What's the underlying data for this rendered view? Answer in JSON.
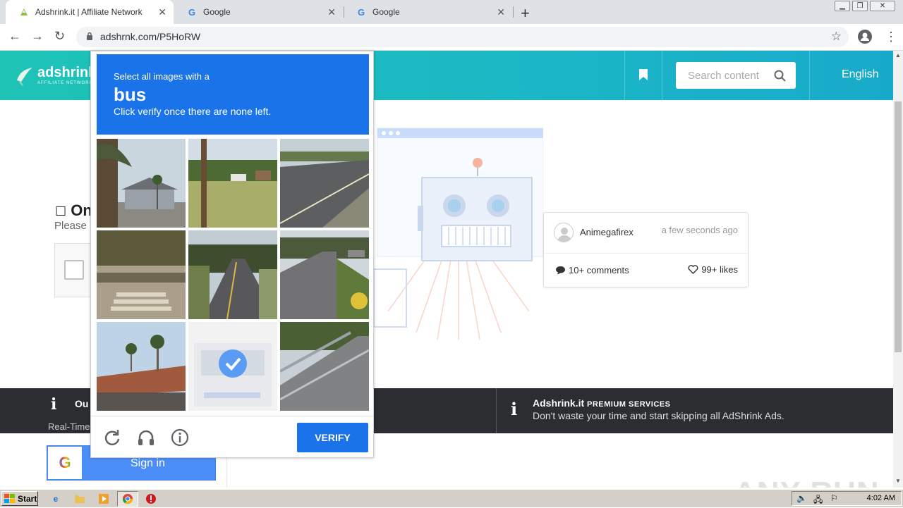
{
  "browser": {
    "tabs": [
      {
        "title": "Adshrink.it | Affiliate Network",
        "active": true
      },
      {
        "title": "Google",
        "active": false
      },
      {
        "title": "Google",
        "active": false
      }
    ],
    "url": "adshrnk.com/P5HoRW"
  },
  "header": {
    "logo_text": "adshrink.it",
    "logo_sub": "AFFILIATE NETWORK",
    "search_placeholder": "Search content",
    "language": "English"
  },
  "main": {
    "title_fragment": "On",
    "subtitle_fragment": "Please",
    "post": {
      "author": "Animegafirex",
      "time": "a few seconds ago",
      "comments": "10+ comments",
      "likes": "99+ likes"
    }
  },
  "banner": {
    "left_icon": "i",
    "left_title": "Ou",
    "left_sub": "Real-Time",
    "right_icon": "i",
    "right_brand": "Adshrink.it",
    "right_title": "PREMIUM SERVICES",
    "right_sub": "Don't waste your time and start skipping all AdShrink Ads."
  },
  "signin": {
    "label": "Sign in",
    "g_letter": "G"
  },
  "captcha": {
    "instruction_line1": "Select all images with a",
    "target": "bus",
    "instruction_line3": "Click verify once there are none left.",
    "verify_label": "VERIFY",
    "tiles": [
      {
        "scene": "palm-house",
        "selected": false
      },
      {
        "scene": "pole-field",
        "selected": false
      },
      {
        "scene": "road-lot",
        "selected": false
      },
      {
        "scene": "steps-bush",
        "selected": false
      },
      {
        "scene": "road-trees",
        "selected": false
      },
      {
        "scene": "street-median",
        "selected": false
      },
      {
        "scene": "roof-palms",
        "selected": false
      },
      {
        "scene": "bus",
        "selected": true
      },
      {
        "scene": "bridge-road",
        "selected": false
      }
    ]
  },
  "watermark": "ANY RUN",
  "taskbar": {
    "start_label": "Start",
    "clock": "4:02 AM"
  },
  "colors": {
    "accent": "#1a73e8",
    "header": "#1fc3b6",
    "banner": "#2b2d31"
  }
}
